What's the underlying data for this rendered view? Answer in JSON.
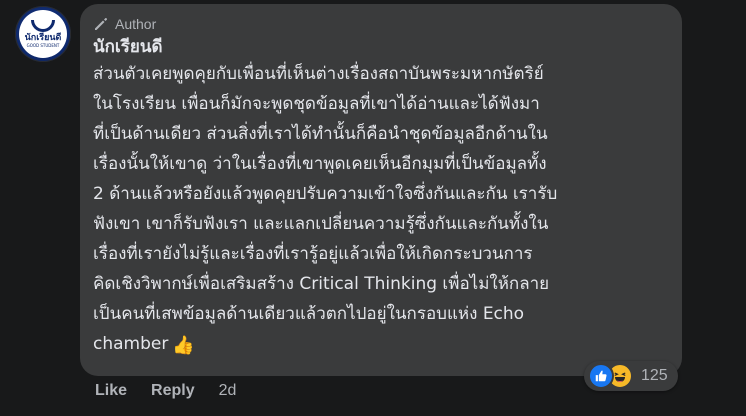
{
  "avatar": {
    "logo_text": "นักเรียนดี",
    "logo_sub": "GOOD STUDENT"
  },
  "comment": {
    "badge_label": "Author",
    "author_name": "นักเรียนดี",
    "lines": [
      "ส่วนตัวเคยพูดคุยกับเพื่อนที่เห็นต่างเรื่องสถาบันพระมหากษัตริย์",
      "ในโรงเรียน เพื่อนก็มักจะพูดชุดข้อมูลที่เขาได้อ่านและได้ฟังมา",
      "ที่เป็นด้านเดียว ส่วนสิ่งที่เราได้ทำนั้นก็คือนำชุดข้อมูลอีกด้านใน",
      "เรื่องนั้นให้เขาดู ว่าในเรื่องที่เขาพูดเคยเห็นอีกมุมที่เป็นข้อมูลทั้ง",
      "2 ด้านแล้วหรือยังแล้วพูดคุยปรับความเข้าใจซึ่งกันและกัน เรารับ",
      "ฟังเขา เขาก็รับฟังเรา และแลกเปลี่ยนความรู้ซึ่งกันและกันทั้งใน",
      "เรื่องที่เรายังไม่รู้และเรื่องที่เรารู้อยู่แล้วเพื่อให้เกิดกระบวนการ",
      "คิดเชิงวิพากษ์เพื่อเสริมสร้าง Critical Thinking เพื่อไม่ให้กลาย",
      "เป็นคนที่เสพข้อมูลด้านเดียวแล้วตกไปอยู่ในกรอบแห่ง Echo",
      "chamber"
    ],
    "trailing_emoji": "👍"
  },
  "reactions": {
    "count": "125",
    "icons": [
      "like-icon",
      "haha-icon"
    ]
  },
  "actions": {
    "like_label": "Like",
    "reply_label": "Reply",
    "timestamp": "2d"
  },
  "colors": {
    "background": "#18191a",
    "bubble": "#3a3b3c",
    "text_primary": "#e4e6eb",
    "text_secondary": "#b0b3b8",
    "like_blue": "#1877f2",
    "haha_yellow": "#f7b928"
  }
}
